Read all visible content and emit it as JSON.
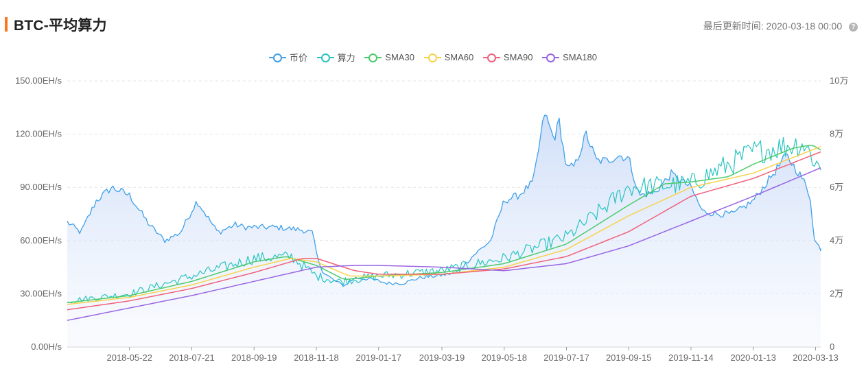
{
  "header": {
    "title": "BTC-平均算力",
    "updated_label": "最后更新时间:",
    "updated_value": "2020-03-18 00:00",
    "info_icon": "question-circle-icon"
  },
  "chart_data": {
    "type": "line",
    "title": "BTC-平均算力",
    "legend": [
      {
        "name": "币价",
        "color": "#3ea0ea"
      },
      {
        "name": "算力",
        "color": "#27c4c1"
      },
      {
        "name": "SMA30",
        "color": "#4ccb6c"
      },
      {
        "name": "SMA60",
        "color": "#f8d24a"
      },
      {
        "name": "SMA90",
        "color": "#f0617a"
      },
      {
        "name": "SMA180",
        "color": "#9965e3"
      }
    ],
    "legend_position": "top-center",
    "x_ticks": [
      "2018-05-22",
      "2018-07-21",
      "2018-09-19",
      "2018-11-18",
      "2019-01-17",
      "2019-03-19",
      "2019-05-18",
      "2019-07-17",
      "2019-09-15",
      "2019-11-14",
      "2020-01-13",
      "2020-03-13"
    ],
    "x_range": [
      "2018-03-23",
      "2020-03-18"
    ],
    "y_left": {
      "ticks": [
        "0.00H/s",
        "30.00EH/s",
        "60.00EH/s",
        "90.00EH/s",
        "120.00EH/s",
        "150.00EH/s"
      ],
      "min": 0,
      "max": 150,
      "unit": "EH/s"
    },
    "y_right": {
      "ticks": [
        "0",
        "2万",
        "4万",
        "6万",
        "8万",
        "10万"
      ],
      "min": 0,
      "max": 100000
    },
    "grid": true,
    "series": [
      {
        "name": "币价",
        "axis": "right",
        "area": true,
        "color": "#3ea0ea",
        "points": [
          [
            "2018-03-23",
            47000
          ],
          [
            "2018-04-05",
            43000
          ],
          [
            "2018-04-20",
            55000
          ],
          [
            "2018-05-05",
            60000
          ],
          [
            "2018-05-22",
            57000
          ],
          [
            "2018-06-10",
            46000
          ],
          [
            "2018-06-25",
            40000
          ],
          [
            "2018-07-10",
            43000
          ],
          [
            "2018-07-26",
            55000
          ],
          [
            "2018-08-15",
            43000
          ],
          [
            "2018-09-01",
            46000
          ],
          [
            "2018-09-10",
            45000
          ],
          [
            "2018-09-19",
            45000
          ],
          [
            "2018-10-10",
            45000
          ],
          [
            "2018-11-05",
            44000
          ],
          [
            "2018-11-14",
            43000
          ],
          [
            "2018-11-20",
            32000
          ],
          [
            "2018-11-25",
            28000
          ],
          [
            "2018-12-05",
            25000
          ],
          [
            "2018-12-15",
            23000
          ],
          [
            "2018-12-25",
            26000
          ],
          [
            "2019-01-10",
            25500
          ],
          [
            "2019-01-25",
            24000
          ],
          [
            "2019-02-10",
            24000
          ],
          [
            "2019-02-25",
            26000
          ],
          [
            "2019-03-19",
            27000
          ],
          [
            "2019-04-02",
            28000
          ],
          [
            "2019-04-20",
            35000
          ],
          [
            "2019-05-05",
            40000
          ],
          [
            "2019-05-18",
            55000
          ],
          [
            "2019-06-01",
            57000
          ],
          [
            "2019-06-15",
            62000
          ],
          [
            "2019-06-26",
            88000
          ],
          [
            "2019-07-05",
            78000
          ],
          [
            "2019-07-10",
            85000
          ],
          [
            "2019-07-17",
            67000
          ],
          [
            "2019-07-25",
            68000
          ],
          [
            "2019-08-05",
            80000
          ],
          [
            "2019-08-15",
            70000
          ],
          [
            "2019-08-25",
            70000
          ],
          [
            "2019-09-05",
            72000
          ],
          [
            "2019-09-15",
            71000
          ],
          [
            "2019-09-25",
            57000
          ],
          [
            "2019-10-10",
            58000
          ],
          [
            "2019-10-26",
            65000
          ],
          [
            "2019-11-14",
            60000
          ],
          [
            "2019-11-25",
            51000
          ],
          [
            "2019-12-10",
            50000
          ],
          [
            "2019-12-25",
            50000
          ],
          [
            "2020-01-13",
            55000
          ],
          [
            "2020-02-01",
            65000
          ],
          [
            "2020-02-14",
            72000
          ],
          [
            "2020-03-01",
            63000
          ],
          [
            "2020-03-08",
            56000
          ],
          [
            "2020-03-12",
            40000
          ],
          [
            "2020-03-18",
            37000
          ]
        ]
      },
      {
        "name": "算力",
        "axis": "left",
        "color": "#27c4c1",
        "points": [
          [
            "2018-03-23",
            26
          ],
          [
            "2018-05-22",
            30
          ],
          [
            "2018-07-21",
            40
          ],
          [
            "2018-09-19",
            50
          ],
          [
            "2018-10-25",
            51
          ],
          [
            "2018-11-18",
            40
          ],
          [
            "2018-12-10",
            37
          ],
          [
            "2019-01-17",
            40
          ],
          [
            "2019-03-19",
            43
          ],
          [
            "2019-05-18",
            50
          ],
          [
            "2019-07-17",
            62
          ],
          [
            "2019-08-15",
            75
          ],
          [
            "2019-09-15",
            90
          ],
          [
            "2019-11-14",
            92
          ],
          [
            "2020-01-13",
            110
          ],
          [
            "2020-03-01",
            115
          ],
          [
            "2020-03-18",
            100
          ]
        ]
      },
      {
        "name": "SMA30",
        "axis": "left",
        "color": "#4ccb6c",
        "points": [
          [
            "2018-03-23",
            25
          ],
          [
            "2018-05-22",
            29
          ],
          [
            "2018-07-21",
            37
          ],
          [
            "2018-09-19",
            48
          ],
          [
            "2018-10-20",
            51
          ],
          [
            "2018-11-18",
            46
          ],
          [
            "2018-12-15",
            38
          ],
          [
            "2019-01-17",
            40
          ],
          [
            "2019-03-19",
            42
          ],
          [
            "2019-05-18",
            47
          ],
          [
            "2019-07-17",
            58
          ],
          [
            "2019-09-15",
            80
          ],
          [
            "2019-10-20",
            92
          ],
          [
            "2019-11-14",
            93
          ],
          [
            "2019-12-20",
            96
          ],
          [
            "2020-01-13",
            103
          ],
          [
            "2020-02-20",
            112
          ],
          [
            "2020-03-10",
            114
          ],
          [
            "2020-03-18",
            111
          ]
        ]
      },
      {
        "name": "SMA60",
        "axis": "left",
        "color": "#f8d24a",
        "points": [
          [
            "2018-03-23",
            24
          ],
          [
            "2018-05-22",
            28
          ],
          [
            "2018-07-21",
            35
          ],
          [
            "2018-09-19",
            45
          ],
          [
            "2018-10-25",
            50
          ],
          [
            "2018-11-18",
            48
          ],
          [
            "2018-12-20",
            40
          ],
          [
            "2019-01-17",
            40
          ],
          [
            "2019-03-19",
            41
          ],
          [
            "2019-05-18",
            45
          ],
          [
            "2019-07-17",
            55
          ],
          [
            "2019-09-15",
            74
          ],
          [
            "2019-11-14",
            90
          ],
          [
            "2020-01-13",
            98
          ],
          [
            "2020-03-18",
            113
          ]
        ]
      },
      {
        "name": "SMA90",
        "axis": "left",
        "color": "#f0617a",
        "points": [
          [
            "2018-03-23",
            21
          ],
          [
            "2018-05-22",
            26
          ],
          [
            "2018-07-21",
            33
          ],
          [
            "2018-09-19",
            42
          ],
          [
            "2018-11-05",
            50
          ],
          [
            "2018-11-18",
            50
          ],
          [
            "2018-12-25",
            43
          ],
          [
            "2019-01-17",
            41
          ],
          [
            "2019-03-19",
            41
          ],
          [
            "2019-05-18",
            44
          ],
          [
            "2019-07-17",
            51
          ],
          [
            "2019-09-15",
            65
          ],
          [
            "2019-11-14",
            85
          ],
          [
            "2020-01-13",
            95
          ],
          [
            "2020-03-18",
            110
          ]
        ]
      },
      {
        "name": "SMA180",
        "axis": "left",
        "color": "#9965e3",
        "points": [
          [
            "2018-03-23",
            15
          ],
          [
            "2018-05-22",
            22
          ],
          [
            "2018-07-21",
            29
          ],
          [
            "2018-09-19",
            37
          ],
          [
            "2018-11-18",
            45
          ],
          [
            "2018-12-25",
            46
          ],
          [
            "2019-01-17",
            46
          ],
          [
            "2019-03-19",
            45
          ],
          [
            "2019-05-18",
            43
          ],
          [
            "2019-07-17",
            47
          ],
          [
            "2019-09-15",
            57
          ],
          [
            "2019-11-14",
            71
          ],
          [
            "2020-01-13",
            85
          ],
          [
            "2020-03-18",
            101
          ]
        ]
      }
    ]
  }
}
